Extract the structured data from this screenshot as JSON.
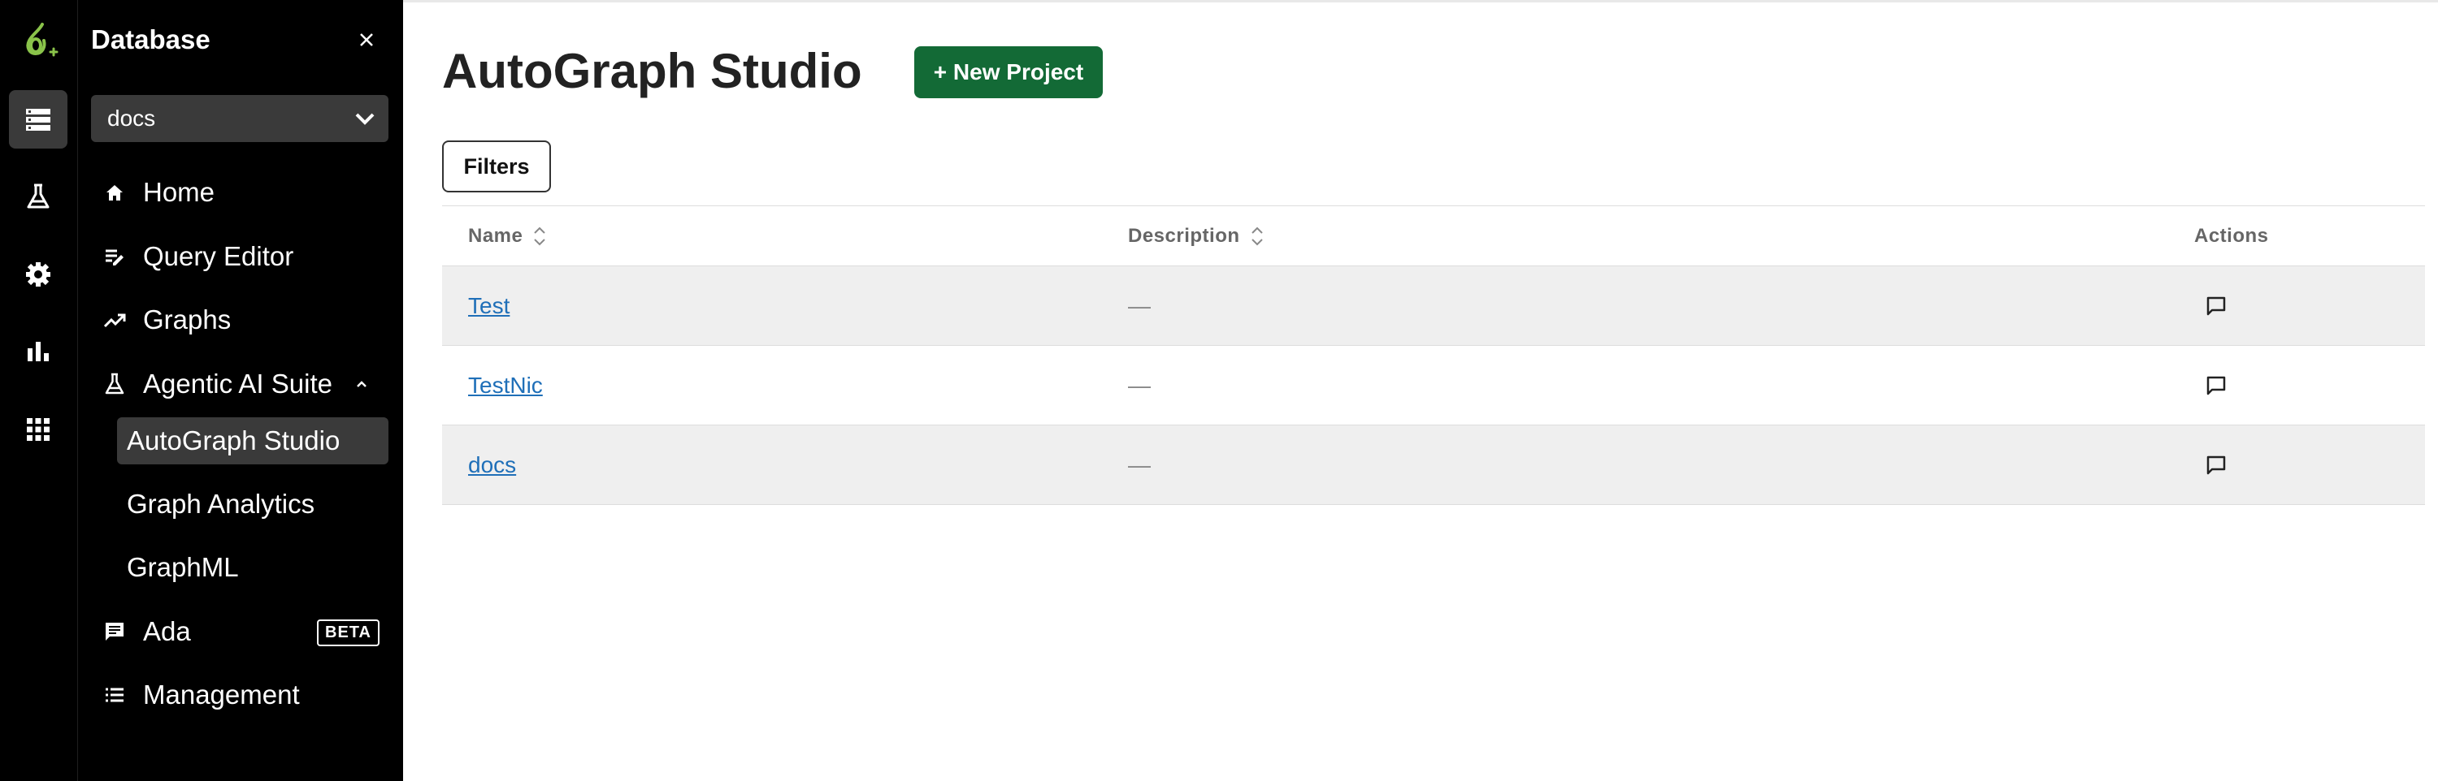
{
  "colors": {
    "sidebar_bg": "#000000",
    "active_bg": "#3a3a3a",
    "primary_button": "#136a36",
    "link": "#1f6fb8",
    "logo_accent": "#8ac34a"
  },
  "rail": {
    "items": [
      {
        "icon": "database-icon",
        "active": true
      },
      {
        "icon": "flask-icon",
        "active": false
      },
      {
        "icon": "gear-icon",
        "active": false
      },
      {
        "icon": "bar-chart-icon",
        "active": false
      },
      {
        "icon": "apps-grid-icon",
        "active": false
      }
    ]
  },
  "nav": {
    "title": "Database",
    "database_select": {
      "value": "docs"
    },
    "items": {
      "home": "Home",
      "query_editor": "Query Editor",
      "graphs": "Graphs",
      "agentic": "Agentic AI Suite",
      "autograph": "AutoGraph Studio",
      "graph_analytics": "Graph Analytics",
      "graphml": "GraphML",
      "ada": "Ada",
      "ada_badge": "BETA",
      "management": "Management"
    }
  },
  "main": {
    "title": "AutoGraph Studio",
    "new_project_label": "+ New Project",
    "filters_label": "Filters",
    "table": {
      "columns": {
        "name": "Name",
        "description": "Description",
        "actions": "Actions"
      },
      "rows": [
        {
          "name": "Test",
          "description": "—"
        },
        {
          "name": "TestNic",
          "description": "—"
        },
        {
          "name": "docs",
          "description": "—"
        }
      ]
    }
  }
}
